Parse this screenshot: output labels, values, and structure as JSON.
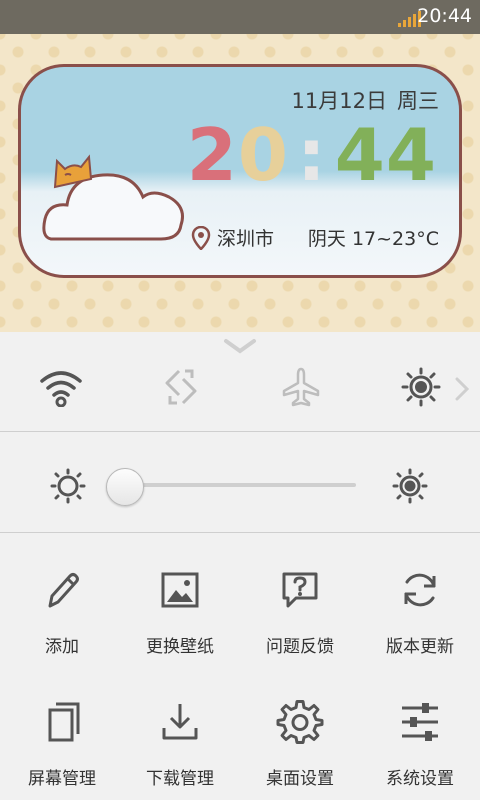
{
  "status_bar": {
    "time": "20:44",
    "signal": "signal-icon"
  },
  "widget": {
    "date": "11月12日",
    "weekday": "周三",
    "clock": {
      "h1": "2",
      "h2": "0",
      "sep": ":",
      "m1": "4",
      "m2": "4"
    },
    "location": "深圳市",
    "weather": "阴天 17~23°C"
  },
  "brightness": {
    "level": 0
  },
  "grid": {
    "row1": [
      {
        "label": "添加",
        "icon": "pencil-icon"
      },
      {
        "label": "更换壁纸",
        "icon": "image-icon"
      },
      {
        "label": "问题反馈",
        "icon": "feedback-icon"
      },
      {
        "label": "版本更新",
        "icon": "refresh-icon"
      }
    ],
    "row2": [
      {
        "label": "屏幕管理",
        "icon": "screens-icon"
      },
      {
        "label": "下载管理",
        "icon": "download-icon"
      },
      {
        "label": "桌面设置",
        "icon": "gear-icon"
      },
      {
        "label": "系统设置",
        "icon": "sliders-icon"
      }
    ]
  },
  "colors": {
    "accent": "#333333",
    "icon_gray": "#bdbdbd",
    "widget_border": "#8a4f4a"
  }
}
